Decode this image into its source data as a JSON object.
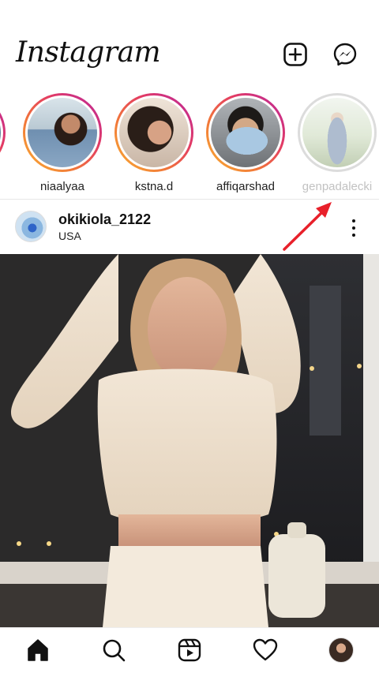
{
  "app": {
    "logo": "Instagram"
  },
  "header": {
    "new_post_icon": "plus-square-icon",
    "messenger_icon": "messenger-icon"
  },
  "stories": [
    {
      "username": "niaalyaa",
      "seen": false
    },
    {
      "username": "kstna.d",
      "seen": false
    },
    {
      "username": "affiqarshad",
      "seen": false
    },
    {
      "username": "genpadalecki",
      "seen": true
    }
  ],
  "post": {
    "username": "okikiola_2122",
    "location": "USA",
    "more_icon": "more-vertical-icon"
  },
  "annotation": {
    "color": "#e8202a"
  },
  "bottom_nav": [
    {
      "icon": "home-icon",
      "active": true
    },
    {
      "icon": "search-icon",
      "active": false
    },
    {
      "icon": "reels-icon",
      "active": false
    },
    {
      "icon": "heart-icon",
      "active": false
    },
    {
      "icon": "profile-avatar",
      "active": false
    }
  ],
  "colors": {
    "story_ring_start": "#f9b232",
    "story_ring_end": "#b726a0",
    "text": "#111111"
  }
}
